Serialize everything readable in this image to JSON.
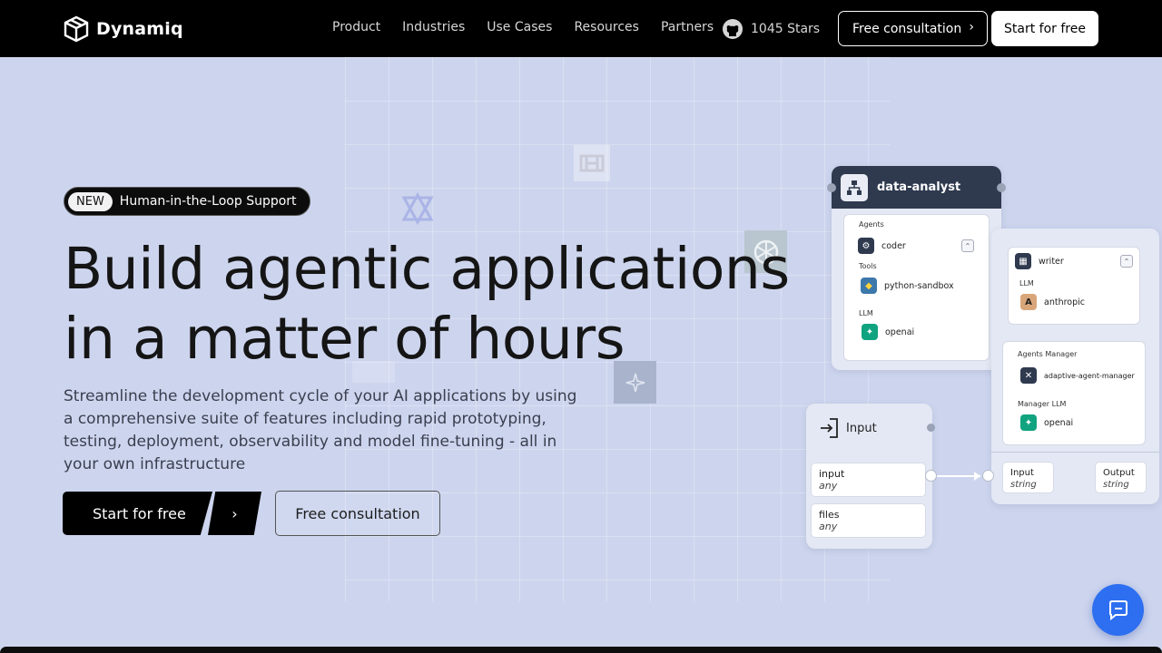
{
  "nav": {
    "brand": "Dynamiq",
    "links": [
      "Product",
      "Industries",
      "Use Cases",
      "Resources",
      "Partners"
    ],
    "github_stars": "1045 Stars",
    "consult_label": "Free consultation",
    "start_label": "Start for free"
  },
  "hero": {
    "badge": "NEW",
    "badge_text": "Human-in-the-Loop Support",
    "title_line1": "Build agentic applications",
    "title_line2": "in a matter of hours",
    "subtitle": "Streamline the development cycle of your AI applications by using a comprehensive suite of features including rapid prototyping, testing, deployment, observability and model fine-tuning - all in your own infrastructure",
    "cta_start": "Start for free",
    "cta_consult": "Free consultation"
  },
  "diagram": {
    "data_analyst": {
      "title": "data-analyst",
      "agents_label": "Agents",
      "agent": "coder",
      "tools_label": "Tools",
      "tool": "python-sandbox",
      "llm_label": "LLM",
      "llm": "openai"
    },
    "writer": {
      "title": "writer",
      "llm_label": "LLM",
      "llm": "anthropic",
      "manager_label": "Agents Manager",
      "manager": "adaptive-agent-manager",
      "manager_llm_label": "Manager LLM",
      "manager_llm": "openai",
      "input_label": "Input",
      "input_type": "string",
      "output_label": "Output",
      "output_type": "string"
    },
    "input_node": {
      "title": "Input",
      "field1_name": "input",
      "field1_type": "any",
      "field2_name": "files",
      "field2_type": "any"
    }
  },
  "colors": {
    "background": "#cdd5ee",
    "nav": "#000000",
    "chat_button": "#2d6ff0",
    "node_header": "#2f3a4f"
  },
  "icons": [
    "dynamiq-logo-icon",
    "github-icon",
    "chevron-right-icon",
    "chat-icon",
    "openai-icon",
    "python-icon",
    "anthropic-icon",
    "cpu-icon",
    "hierarchy-icon",
    "login-icon"
  ]
}
